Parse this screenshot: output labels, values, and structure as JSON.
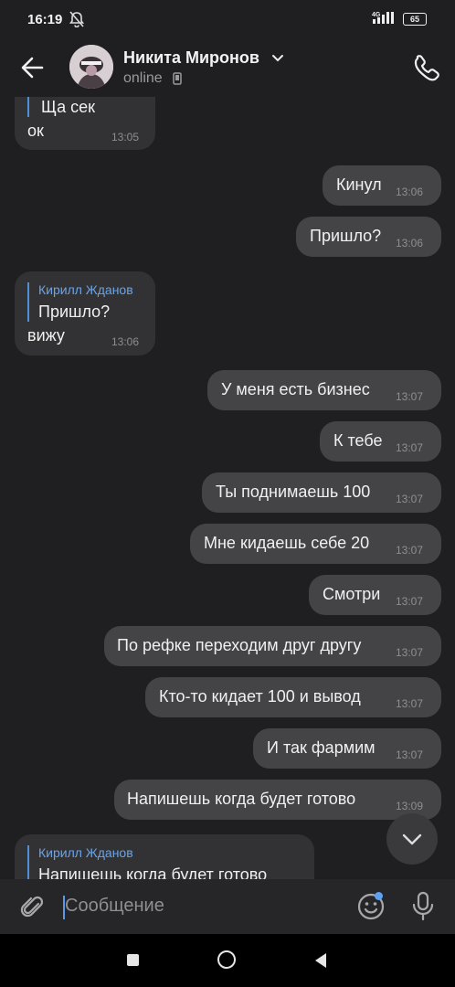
{
  "status_bar": {
    "time": "16:19",
    "network": "4G",
    "battery": "65"
  },
  "header": {
    "name": "Никита Миронов",
    "status": "online"
  },
  "messages": [
    {
      "dir": "in",
      "lines": [
        "Ща сек",
        "ок"
      ],
      "time": "13:05"
    },
    {
      "dir": "out",
      "text": "Кинул",
      "time": "13:06"
    },
    {
      "dir": "out",
      "text": "Пришло?",
      "time": "13:06"
    },
    {
      "dir": "in",
      "reply_author": "Кирилл Жданов",
      "reply_text": "Пришло?",
      "text": "вижу",
      "time": "13:06"
    },
    {
      "dir": "out",
      "text": "У меня есть бизнес",
      "time": "13:07"
    },
    {
      "dir": "out",
      "text": "К тебе",
      "time": "13:07"
    },
    {
      "dir": "out",
      "text": "Ты поднимаешь 100",
      "time": "13:07"
    },
    {
      "dir": "out",
      "text": "Мне кидаешь себе 20",
      "time": "13:07"
    },
    {
      "dir": "out",
      "text": "Смотри",
      "time": "13:07"
    },
    {
      "dir": "out",
      "text": "По рефке переходим друг другу",
      "time": "13:07"
    },
    {
      "dir": "out",
      "text": "Кто-то кидает 100 и вывод",
      "time": "13:07"
    },
    {
      "dir": "out",
      "text": "И так фармим",
      "time": "13:07"
    },
    {
      "dir": "out",
      "text": "Напишешь когда будет готово",
      "time": "13:09"
    },
    {
      "dir": "in",
      "reply_author": "Кирилл Жданов",
      "reply_text": "Напишешь когда будет готово"
    }
  ],
  "composer": {
    "placeholder": "Сообщение"
  },
  "icons": {
    "back": "arrow-left-icon",
    "chevron": "chevron-down-icon",
    "device": "phone-device-icon",
    "call": "phone-call-icon",
    "attach": "paperclip-icon",
    "emoji": "smiley-icon",
    "mic": "microphone-icon",
    "scroll": "chevron-down-icon",
    "mute": "bell-off-icon"
  },
  "colors": {
    "background": "#1f1f21",
    "outgoing": "#444447",
    "incoming": "#323234",
    "accent": "#6aa4e8"
  }
}
